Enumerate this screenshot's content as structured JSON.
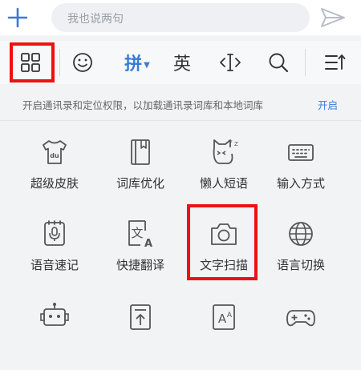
{
  "composer": {
    "placeholder": "我也说两句",
    "plus_icon": "plus-icon",
    "send_icon": "send-icon"
  },
  "toolbar": {
    "items": [
      {
        "icon": "grid-menu-icon"
      },
      {
        "icon": "emoji-icon"
      },
      {
        "label": "拼",
        "state": "active"
      },
      {
        "label": "英"
      },
      {
        "icon": "cursor-move-icon"
      },
      {
        "icon": "search-icon"
      },
      {
        "icon": "collapse-icon"
      }
    ]
  },
  "notice": {
    "text": "开启通讯录和定位权限，以加载通讯录词库和本地词库",
    "action": "开启"
  },
  "grid": {
    "items": [
      {
        "label": "超级皮肤",
        "icon": "skin-tshirt-icon"
      },
      {
        "label": "词库优化",
        "icon": "dictionary-icon"
      },
      {
        "label": "懒人短语",
        "icon": "lazy-cat-icon"
      },
      {
        "label": "输入方式",
        "icon": "keyboard-icon"
      },
      {
        "label": "语音速记",
        "icon": "voice-note-icon"
      },
      {
        "label": "快捷翻译",
        "icon": "translate-icon"
      },
      {
        "label": "文字扫描",
        "icon": "camera-icon"
      },
      {
        "label": "语言切换",
        "icon": "globe-icon"
      },
      {
        "label": "",
        "icon": "robot-icon"
      },
      {
        "label": "",
        "icon": "document-upload-icon"
      },
      {
        "label": "",
        "icon": "font-size-icon"
      },
      {
        "label": "",
        "icon": "gamepad-icon"
      }
    ]
  },
  "colors": {
    "accent": "#3a7bd5",
    "highlight": "#e11111"
  }
}
